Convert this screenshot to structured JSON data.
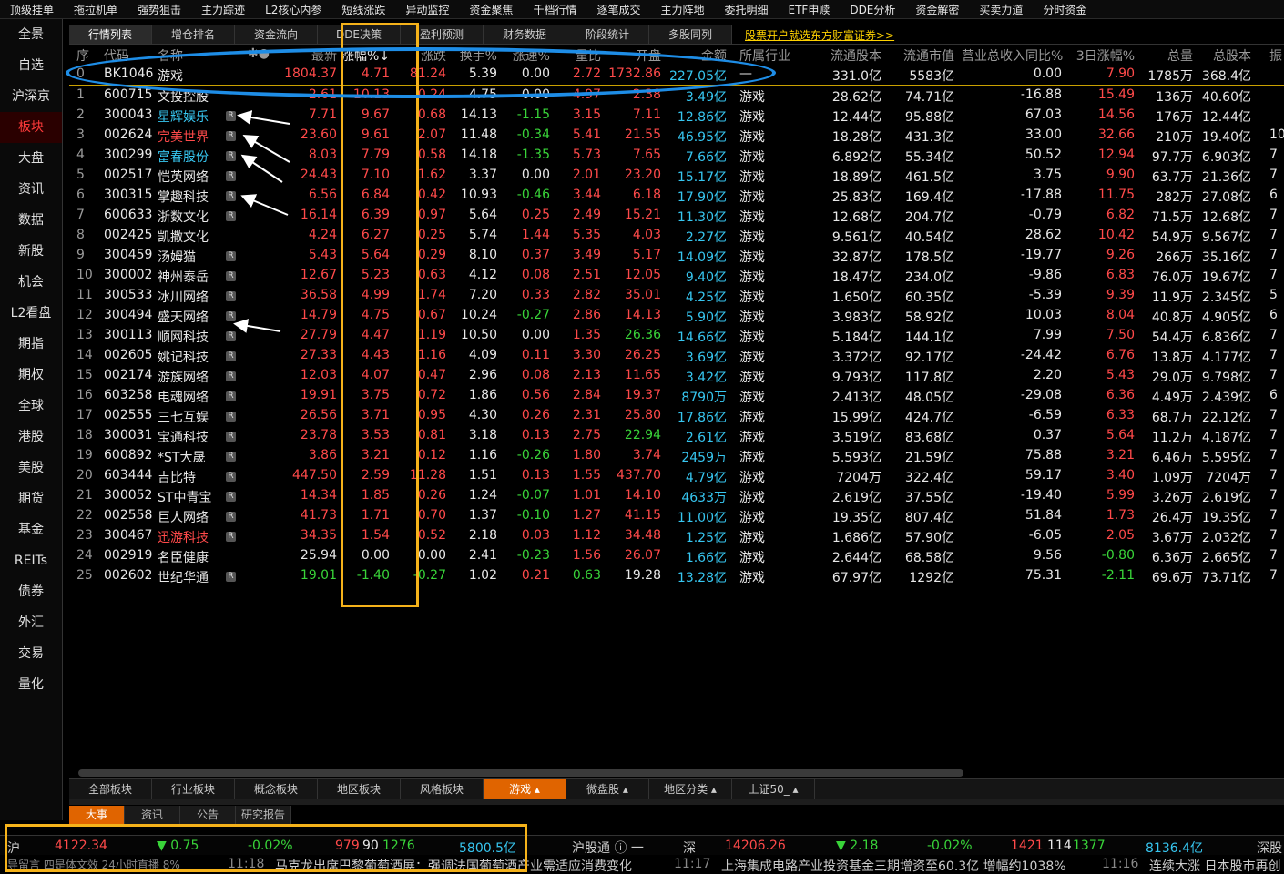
{
  "top_menu": [
    "顶级挂单",
    "拖拉机单",
    "强势狙击",
    "主力踪迹",
    "L2核心内参",
    "短线涨跌",
    "异动监控",
    "资金聚焦",
    "千档行情",
    "逐笔成交",
    "主力阵地",
    "委托明细",
    "ETF申赎",
    "DDE分析",
    "资金解密",
    "买卖力道",
    "分时资金"
  ],
  "left_nav": [
    "全景",
    "自选",
    "沪深京",
    "板块",
    "大盘",
    "资讯",
    "数据",
    "新股",
    "机会",
    "L2看盘",
    "期指",
    "期权",
    "全球",
    "港股",
    "美股",
    "期货",
    "基金",
    "REITs",
    "债券",
    "外汇",
    "交易",
    "量化"
  ],
  "left_nav_active": 3,
  "top_tabs": [
    "行情列表",
    "增仓排名",
    "资金流向",
    "DDE决策",
    "盈利预测",
    "财务数据",
    "阶段统计",
    "多股同列"
  ],
  "promo_link": "股票开户就选东方财富证券>>",
  "columns": [
    "序",
    "代码",
    "名称",
    "✱●",
    "最新",
    "涨幅%↓",
    "涨跌",
    "换手%",
    "涨速%",
    "量比",
    "开盘",
    "金额",
    "所属行业",
    "流通股本",
    "流通市值",
    "营业总收入同比%",
    "3日涨幅%",
    "总量",
    "总股本",
    "振"
  ],
  "rows": [
    {
      "idx": "0",
      "code": "BK1046",
      "name": "游戏",
      "last": "1804.37",
      "pct": "4.71",
      "chg": "81.24",
      "turn": "5.39",
      "speed": "0.00",
      "vr": "2.72",
      "open": "1732.86",
      "amt": "227.05亿",
      "ind": "—",
      "fs": "331.0亿",
      "fmv": "5583亿",
      "rev": "0.00",
      "d3": "7.90",
      "vol": "1785万",
      "ts": "368.4亿",
      "z": ""
    },
    {
      "idx": "1",
      "code": "600715",
      "name": "文投控股",
      "last": "2.61",
      "pct": "10.13",
      "chg": "0.24",
      "turn": "4.75",
      "speed": "0.00",
      "vr": "4.97",
      "open": "2.38",
      "amt": "3.49亿",
      "ind": "游戏",
      "fs": "28.62亿",
      "fmv": "74.71亿",
      "rev": "-16.88",
      "d3": "15.49",
      "vol": "136万",
      "ts": "40.60亿",
      "z": ""
    },
    {
      "idx": "2",
      "code": "300043",
      "name": "星辉娱乐",
      "last": "7.71",
      "pct": "9.67",
      "chg": "0.68",
      "turn": "14.13",
      "speed": "-1.15",
      "vr": "3.15",
      "open": "7.11",
      "amt": "12.86亿",
      "ind": "游戏",
      "fs": "12.44亿",
      "fmv": "95.88亿",
      "rev": "67.03",
      "d3": "14.56",
      "vol": "176万",
      "ts": "12.44亿",
      "z": ""
    },
    {
      "idx": "3",
      "code": "002624",
      "name": "完美世界",
      "last": "23.60",
      "pct": "9.61",
      "chg": "2.07",
      "turn": "11.48",
      "speed": "-0.34",
      "vr": "5.41",
      "open": "21.55",
      "amt": "46.95亿",
      "ind": "游戏",
      "fs": "18.28亿",
      "fmv": "431.3亿",
      "rev": "33.00",
      "d3": "32.66",
      "vol": "210万",
      "ts": "19.40亿",
      "z": "10"
    },
    {
      "idx": "4",
      "code": "300299",
      "name": "富春股份",
      "last": "8.03",
      "pct": "7.79",
      "chg": "0.58",
      "turn": "14.18",
      "speed": "-1.35",
      "vr": "5.73",
      "open": "7.65",
      "amt": "7.66亿",
      "ind": "游戏",
      "fs": "6.892亿",
      "fmv": "55.34亿",
      "rev": "50.52",
      "d3": "12.94",
      "vol": "97.7万",
      "ts": "6.903亿",
      "z": "7"
    },
    {
      "idx": "5",
      "code": "002517",
      "name": "恺英网络",
      "last": "24.43",
      "pct": "7.10",
      "chg": "1.62",
      "turn": "3.37",
      "speed": "0.00",
      "vr": "2.01",
      "open": "23.20",
      "amt": "15.17亿",
      "ind": "游戏",
      "fs": "18.89亿",
      "fmv": "461.5亿",
      "rev": "3.75",
      "d3": "9.90",
      "vol": "63.7万",
      "ts": "21.36亿",
      "z": "7"
    },
    {
      "idx": "6",
      "code": "300315",
      "name": "掌趣科技",
      "last": "6.56",
      "pct": "6.84",
      "chg": "0.42",
      "turn": "10.93",
      "speed": "-0.46",
      "vr": "3.44",
      "open": "6.18",
      "amt": "17.90亿",
      "ind": "游戏",
      "fs": "25.83亿",
      "fmv": "169.4亿",
      "rev": "-17.88",
      "d3": "11.75",
      "vol": "282万",
      "ts": "27.08亿",
      "z": "6"
    },
    {
      "idx": "7",
      "code": "600633",
      "name": "浙数文化",
      "last": "16.14",
      "pct": "6.39",
      "chg": "0.97",
      "turn": "5.64",
      "speed": "0.25",
      "vr": "2.49",
      "open": "15.21",
      "amt": "11.30亿",
      "ind": "游戏",
      "fs": "12.68亿",
      "fmv": "204.7亿",
      "rev": "-0.79",
      "d3": "6.82",
      "vol": "71.5万",
      "ts": "12.68亿",
      "z": "7"
    },
    {
      "idx": "8",
      "code": "002425",
      "name": "凯撒文化",
      "last": "4.24",
      "pct": "6.27",
      "chg": "0.25",
      "turn": "5.74",
      "speed": "1.44",
      "vr": "5.35",
      "open": "4.03",
      "amt": "2.27亿",
      "ind": "游戏",
      "fs": "9.561亿",
      "fmv": "40.54亿",
      "rev": "28.62",
      "d3": "10.42",
      "vol": "54.9万",
      "ts": "9.567亿",
      "z": "7"
    },
    {
      "idx": "9",
      "code": "300459",
      "name": "汤姆猫",
      "last": "5.43",
      "pct": "5.64",
      "chg": "0.29",
      "turn": "8.10",
      "speed": "0.37",
      "vr": "3.49",
      "open": "5.17",
      "amt": "14.09亿",
      "ind": "游戏",
      "fs": "32.87亿",
      "fmv": "178.5亿",
      "rev": "-19.77",
      "d3": "9.26",
      "vol": "266万",
      "ts": "35.16亿",
      "z": "7"
    },
    {
      "idx": "10",
      "code": "300002",
      "name": "神州泰岳",
      "last": "12.67",
      "pct": "5.23",
      "chg": "0.63",
      "turn": "4.12",
      "speed": "0.08",
      "vr": "2.51",
      "open": "12.05",
      "amt": "9.40亿",
      "ind": "游戏",
      "fs": "18.47亿",
      "fmv": "234.0亿",
      "rev": "-9.86",
      "d3": "6.83",
      "vol": "76.0万",
      "ts": "19.67亿",
      "z": "7"
    },
    {
      "idx": "11",
      "code": "300533",
      "name": "冰川网络",
      "last": "36.58",
      "pct": "4.99",
      "chg": "1.74",
      "turn": "7.20",
      "speed": "0.33",
      "vr": "2.82",
      "open": "35.01",
      "amt": "4.25亿",
      "ind": "游戏",
      "fs": "1.650亿",
      "fmv": "60.35亿",
      "rev": "-5.39",
      "d3": "9.39",
      "vol": "11.9万",
      "ts": "2.345亿",
      "z": "5"
    },
    {
      "idx": "12",
      "code": "300494",
      "name": "盛天网络",
      "last": "14.79",
      "pct": "4.75",
      "chg": "0.67",
      "turn": "10.24",
      "speed": "-0.27",
      "vr": "2.86",
      "open": "14.13",
      "amt": "5.90亿",
      "ind": "游戏",
      "fs": "3.983亿",
      "fmv": "58.92亿",
      "rev": "10.03",
      "d3": "8.04",
      "vol": "40.8万",
      "ts": "4.905亿",
      "z": "6"
    },
    {
      "idx": "13",
      "code": "300113",
      "name": "顺网科技",
      "last": "27.79",
      "pct": "4.47",
      "chg": "1.19",
      "turn": "10.50",
      "speed": "0.00",
      "vr": "1.35",
      "open": "26.36",
      "amt": "14.66亿",
      "ind": "游戏",
      "fs": "5.184亿",
      "fmv": "144.1亿",
      "rev": "7.99",
      "d3": "7.50",
      "vol": "54.4万",
      "ts": "6.836亿",
      "z": "7"
    },
    {
      "idx": "14",
      "code": "002605",
      "name": "姚记科技",
      "last": "27.33",
      "pct": "4.43",
      "chg": "1.16",
      "turn": "4.09",
      "speed": "0.11",
      "vr": "3.30",
      "open": "26.25",
      "amt": "3.69亿",
      "ind": "游戏",
      "fs": "3.372亿",
      "fmv": "92.17亿",
      "rev": "-24.42",
      "d3": "6.76",
      "vol": "13.8万",
      "ts": "4.177亿",
      "z": "7"
    },
    {
      "idx": "15",
      "code": "002174",
      "name": "游族网络",
      "last": "12.03",
      "pct": "4.07",
      "chg": "0.47",
      "turn": "2.96",
      "speed": "0.08",
      "vr": "2.13",
      "open": "11.65",
      "amt": "3.42亿",
      "ind": "游戏",
      "fs": "9.793亿",
      "fmv": "117.8亿",
      "rev": "2.20",
      "d3": "5.43",
      "vol": "29.0万",
      "ts": "9.798亿",
      "z": "7"
    },
    {
      "idx": "16",
      "code": "603258",
      "name": "电魂网络",
      "last": "19.91",
      "pct": "3.75",
      "chg": "0.72",
      "turn": "1.86",
      "speed": "0.56",
      "vr": "2.84",
      "open": "19.37",
      "amt": "8790万",
      "ind": "游戏",
      "fs": "2.413亿",
      "fmv": "48.05亿",
      "rev": "-29.08",
      "d3": "6.36",
      "vol": "4.49万",
      "ts": "2.439亿",
      "z": "6"
    },
    {
      "idx": "17",
      "code": "002555",
      "name": "三七互娱",
      "last": "26.56",
      "pct": "3.71",
      "chg": "0.95",
      "turn": "4.30",
      "speed": "0.26",
      "vr": "2.31",
      "open": "25.80",
      "amt": "17.86亿",
      "ind": "游戏",
      "fs": "15.99亿",
      "fmv": "424.7亿",
      "rev": "-6.59",
      "d3": "6.33",
      "vol": "68.7万",
      "ts": "22.12亿",
      "z": "7"
    },
    {
      "idx": "18",
      "code": "300031",
      "name": "宝通科技",
      "last": "23.78",
      "pct": "3.53",
      "chg": "0.81",
      "turn": "3.18",
      "speed": "0.13",
      "vr": "2.75",
      "open": "22.94",
      "amt": "2.61亿",
      "ind": "游戏",
      "fs": "3.519亿",
      "fmv": "83.68亿",
      "rev": "0.37",
      "d3": "5.64",
      "vol": "11.2万",
      "ts": "4.187亿",
      "z": "7"
    },
    {
      "idx": "19",
      "code": "600892",
      "name": "*ST大晟",
      "last": "3.86",
      "pct": "3.21",
      "chg": "0.12",
      "turn": "1.16",
      "speed": "-0.26",
      "vr": "1.80",
      "open": "3.74",
      "amt": "2459万",
      "ind": "游戏",
      "fs": "5.593亿",
      "fmv": "21.59亿",
      "rev": "75.88",
      "d3": "3.21",
      "vol": "6.46万",
      "ts": "5.595亿",
      "z": "7"
    },
    {
      "idx": "20",
      "code": "603444",
      "name": "吉比特",
      "last": "447.50",
      "pct": "2.59",
      "chg": "11.28",
      "turn": "1.51",
      "speed": "0.13",
      "vr": "1.55",
      "open": "437.70",
      "amt": "4.79亿",
      "ind": "游戏",
      "fs": "7204万",
      "fmv": "322.4亿",
      "rev": "59.17",
      "d3": "3.40",
      "vol": "1.09万",
      "ts": "7204万",
      "z": "7"
    },
    {
      "idx": "21",
      "code": "300052",
      "name": "ST中青宝",
      "last": "14.34",
      "pct": "1.85",
      "chg": "0.26",
      "turn": "1.24",
      "speed": "-0.07",
      "vr": "1.01",
      "open": "14.10",
      "amt": "4633万",
      "ind": "游戏",
      "fs": "2.619亿",
      "fmv": "37.55亿",
      "rev": "-19.40",
      "d3": "5.99",
      "vol": "3.26万",
      "ts": "2.619亿",
      "z": "7"
    },
    {
      "idx": "22",
      "code": "002558",
      "name": "巨人网络",
      "last": "41.73",
      "pct": "1.71",
      "chg": "0.70",
      "turn": "1.37",
      "speed": "-0.10",
      "vr": "1.27",
      "open": "41.15",
      "amt": "11.00亿",
      "ind": "游戏",
      "fs": "19.35亿",
      "fmv": "807.4亿",
      "rev": "51.84",
      "d3": "1.73",
      "vol": "26.4万",
      "ts": "19.35亿",
      "z": "7"
    },
    {
      "idx": "23",
      "code": "300467",
      "name": "迅游科技",
      "last": "34.35",
      "pct": "1.54",
      "chg": "0.52",
      "turn": "2.18",
      "speed": "0.03",
      "vr": "1.12",
      "open": "34.48",
      "amt": "1.25亿",
      "ind": "游戏",
      "fs": "1.686亿",
      "fmv": "57.90亿",
      "rev": "-6.05",
      "d3": "2.05",
      "vol": "3.67万",
      "ts": "2.032亿",
      "z": "7"
    },
    {
      "idx": "24",
      "code": "002919",
      "name": "名臣健康",
      "last": "25.94",
      "pct": "0.00",
      "chg": "0.00",
      "turn": "2.41",
      "speed": "-0.23",
      "vr": "1.56",
      "open": "26.07",
      "amt": "1.66亿",
      "ind": "游戏",
      "fs": "2.644亿",
      "fmv": "68.58亿",
      "rev": "9.56",
      "d3": "-0.80",
      "vol": "6.36万",
      "ts": "2.665亿",
      "z": "7"
    },
    {
      "idx": "25",
      "code": "002602",
      "name": "世纪华通",
      "last": "19.01",
      "pct": "-1.40",
      "chg": "-0.27",
      "turn": "1.02",
      "speed": "0.21",
      "vr": "0.63",
      "open": "19.28",
      "amt": "13.28亿",
      "ind": "游戏",
      "fs": "67.97亿",
      "fmv": "1292亿",
      "rev": "75.31",
      "d3": "-2.11",
      "vol": "69.6万",
      "ts": "73.71亿",
      "z": "7"
    }
  ],
  "bottom_tabs": [
    "全部板块",
    "行业板块",
    "概念板块",
    "地区板块",
    "风格板块",
    "游戏 ▴",
    "微盘股 ▴",
    "地区分类 ▴",
    "上证50_ ▴"
  ],
  "bottom_tabs_active": 5,
  "news_tabs": [
    "大事",
    "资讯",
    "公告",
    "研究报告"
  ],
  "status": {
    "sh_label": "沪",
    "sh_index": "4122.34",
    "sh_chg": "▼ 0.75",
    "sh_pct": "-0.02%",
    "sh_up": "979",
    "sh_flat": "90",
    "sh_down": "1276",
    "sh_amt": "5800.5亿",
    "hgt_label": "沪股通 ⓘ 一",
    "sz_label": "深",
    "sz_index": "14206.26",
    "sz_chg": "▼ 2.18",
    "sz_pct": "-0.02%",
    "sz_up": "1421",
    "sz_flat": "114",
    "sz_down": "1377",
    "sz_amt": "8136.4亿",
    "sgt_label": "深股"
  },
  "ticker": {
    "left": "导留言  四是体文效  24小时直播  8%",
    "t1": "11:18",
    "m1": "马克龙出席巴黎葡萄酒展：强调法国葡萄酒产业需适应消费变化",
    "t2": "11:17",
    "m2": "上海集成电路产业投资基金三期增资至60.3亿  增幅约1038%",
    "t3": "11:16",
    "m3": "连续大涨  日本股市再创"
  },
  "colors": {
    "up": "#ff4a4a",
    "down": "#39d439",
    "amount": "#37c6f0",
    "accent": "#e06400",
    "highlight_box": "#f5b21a",
    "ellipse": "#1e8de6"
  }
}
